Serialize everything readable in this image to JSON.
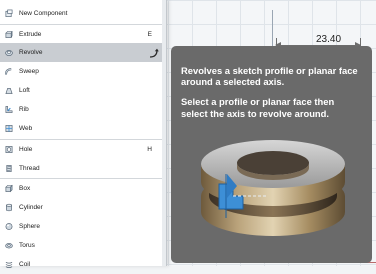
{
  "dimension": {
    "value": "23.40"
  },
  "menu": {
    "items": [
      {
        "label": "New Component",
        "shortcut": "",
        "icon": "new-component-icon"
      },
      {
        "label": "Extrude",
        "shortcut": "E",
        "icon": "extrude-icon"
      },
      {
        "label": "Revolve",
        "shortcut": "",
        "icon": "revolve-icon",
        "highlighted": true
      },
      {
        "label": "Sweep",
        "shortcut": "",
        "icon": "sweep-icon"
      },
      {
        "label": "Loft",
        "shortcut": "",
        "icon": "loft-icon"
      },
      {
        "label": "Rib",
        "shortcut": "",
        "icon": "rib-icon"
      },
      {
        "label": "Web",
        "shortcut": "",
        "icon": "web-icon"
      },
      {
        "label": "Hole",
        "shortcut": "H",
        "icon": "hole-icon"
      },
      {
        "label": "Thread",
        "shortcut": "",
        "icon": "thread-icon"
      },
      {
        "label": "Box",
        "shortcut": "",
        "icon": "box-icon"
      },
      {
        "label": "Cylinder",
        "shortcut": "",
        "icon": "cylinder-icon"
      },
      {
        "label": "Sphere",
        "shortcut": "",
        "icon": "sphere-icon"
      },
      {
        "label": "Torus",
        "shortcut": "",
        "icon": "torus-icon"
      },
      {
        "label": "Coil",
        "shortcut": "",
        "icon": "coil-icon"
      }
    ]
  },
  "tooltip": {
    "line1": "Revolves a sketch profile or planar face around a selected axis.",
    "line2": "Select a profile or planar face then select the axis to revolve around."
  },
  "colors": {
    "accent": "#3d8fd6",
    "highlight": "#c9cdd2",
    "tooltip_bg": "#6a6a6a"
  }
}
